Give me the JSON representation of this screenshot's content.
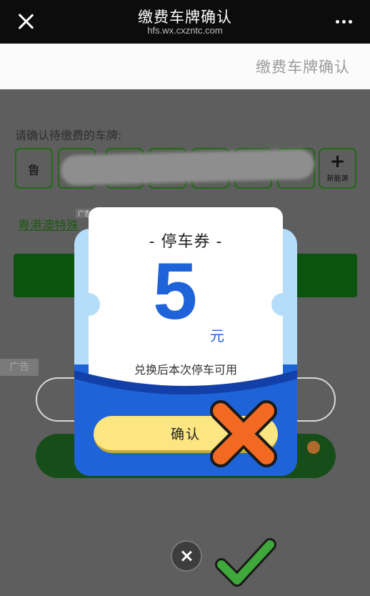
{
  "nav": {
    "title": "缴费车牌确认",
    "subtitle": "hfs.wx.cxzntc.com",
    "close_icon": "close-icon",
    "more_icon": "more-icon"
  },
  "page_header": {
    "title": "缴费车牌确认"
  },
  "form": {
    "prompt": "请确认待缴费的车牌:",
    "plate_first_char": "鲁",
    "new_energy_plus": "+",
    "new_energy_label": "新能源",
    "ad_link_text": "粤港澳特殊",
    "ad_small_tag": "广告",
    "ad_tag": "广告"
  },
  "popup": {
    "title": "- 停车券 -",
    "amount": "5",
    "unit": "元",
    "description": "兑换后本次停车可用",
    "confirm_label": "确认"
  },
  "colors": {
    "nav_bg": "#0c0c0c",
    "coupon_blue": "#1f63da",
    "confirm_yellow": "#fbe681",
    "overlay_x_orange": "#f26a21",
    "check_green": "#3ea93a",
    "page_green": "#0a5410"
  }
}
